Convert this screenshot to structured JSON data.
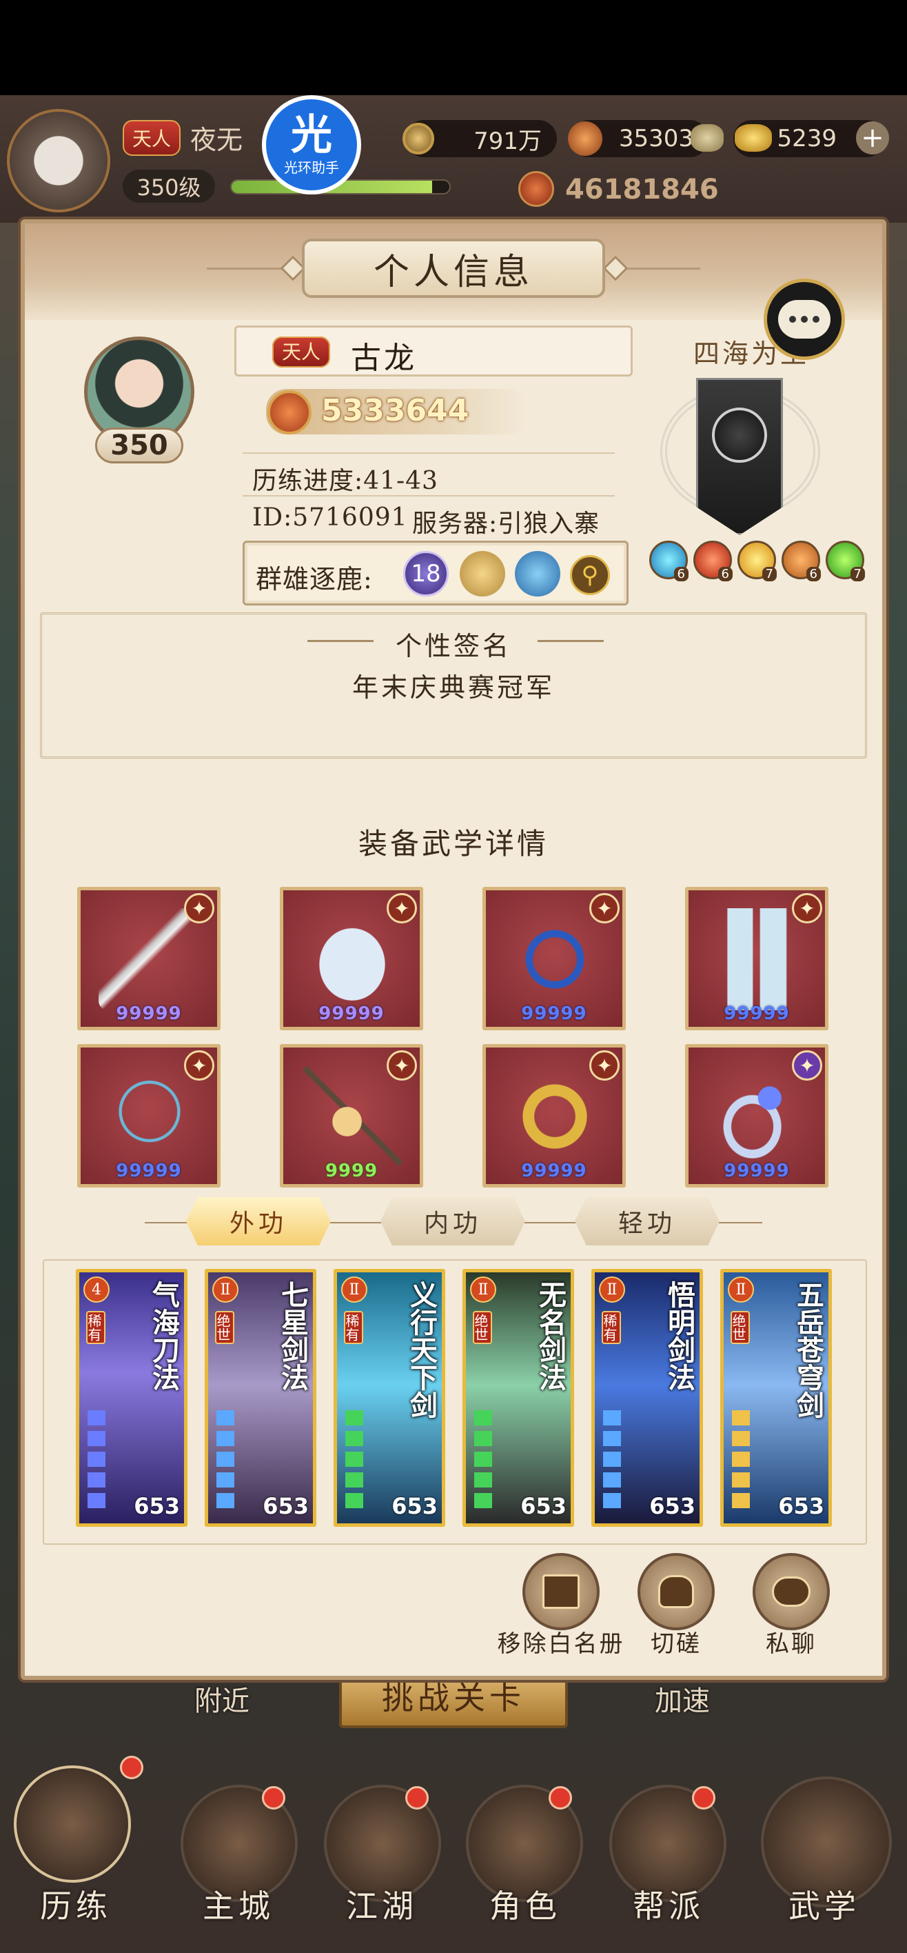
{
  "topbar": {
    "title_badge": "天人",
    "player_name": "夜无",
    "level": "350级",
    "coins": "791万",
    "silver": "35303",
    "gold": "5239",
    "power": "46181846"
  },
  "overlay": {
    "helper_top": "光",
    "helper_label": "光环助手"
  },
  "dialog": {
    "title": "个人信息"
  },
  "profile": {
    "level": "350",
    "title_badge": "天人",
    "name": "古龙",
    "power": "5333644",
    "progress": "历练进度:41-43",
    "id": "ID:5716091",
    "server": "服务器:引狼入寨",
    "qunxiong_label": "群雄逐鹿:",
    "qunxiong_rank": "18",
    "clan_title": "四海为王",
    "element_counts": [
      "6",
      "6",
      "7",
      "6",
      "7"
    ]
  },
  "signature": {
    "label": "个性签名",
    "text": "年末庆典赛冠军"
  },
  "equip": {
    "title": "装备武学详情",
    "items": [
      {
        "name": "sword",
        "pips": "99999",
        "color": "#8a7cff"
      },
      {
        "name": "robe",
        "pips": "99999",
        "color": "#8a7cff"
      },
      {
        "name": "belt",
        "pips": "99999",
        "color": "#4b7bff"
      },
      {
        "name": "boots",
        "pips": "99999",
        "color": "#4b7bff"
      },
      {
        "name": "necklace",
        "pips": "99999",
        "color": "#4b7bff"
      },
      {
        "name": "hairpin",
        "pips": "9999",
        "color": "#6fd23b"
      },
      {
        "name": "bracelet",
        "pips": "99999",
        "color": "#4b7bff"
      },
      {
        "name": "ring",
        "pips": "99999",
        "color": "#4b7bff"
      }
    ]
  },
  "tabs": [
    "外功",
    "内功",
    "轻功"
  ],
  "martial": [
    {
      "name": "气海刀法",
      "tag": "稀有",
      "level": "653",
      "rank": "4"
    },
    {
      "name": "七星剑法",
      "tag": "绝世",
      "level": "653",
      "rank": "Ⅱ"
    },
    {
      "name": "义行天下剑",
      "tag": "稀有",
      "level": "653",
      "rank": "Ⅱ"
    },
    {
      "name": "无名剑法",
      "tag": "绝世",
      "level": "653",
      "rank": "Ⅱ"
    },
    {
      "name": "悟明剑法",
      "tag": "稀有",
      "level": "653",
      "rank": "Ⅱ"
    },
    {
      "name": "五岳苍穹剑",
      "tag": "绝世",
      "level": "653",
      "rank": "Ⅱ"
    }
  ],
  "actions": {
    "remove": "移除白名册",
    "spar": "切磋",
    "chat": "私聊"
  },
  "background": {
    "nearby": "附近",
    "challenge": "挑战关卡",
    "speed": "加速"
  },
  "nav": [
    "历练",
    "主城",
    "江湖",
    "角色",
    "帮派",
    "武学"
  ]
}
